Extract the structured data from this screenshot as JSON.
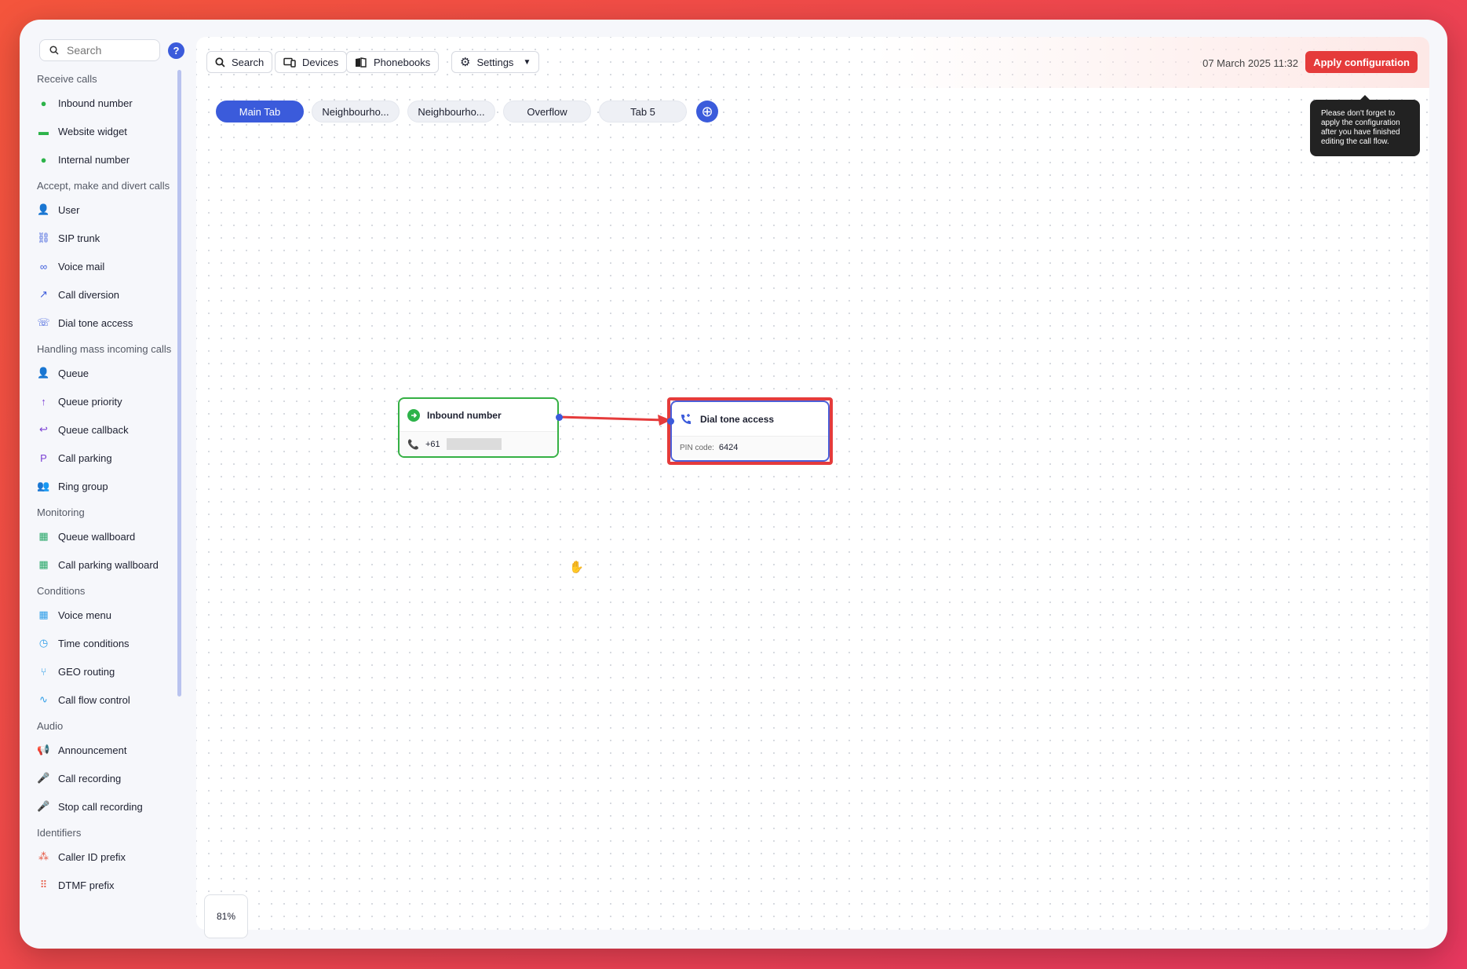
{
  "sidebar": {
    "search_placeholder": "Search",
    "help_label": "?",
    "sections": [
      {
        "title": "Receive calls",
        "items": [
          {
            "label": "Inbound number",
            "icon": "inbound-number-icon",
            "color": "#2db34a"
          },
          {
            "label": "Website widget",
            "icon": "website-widget-icon",
            "color": "#2db34a"
          },
          {
            "label": "Internal number",
            "icon": "internal-number-icon",
            "color": "#2db34a"
          }
        ]
      },
      {
        "title": "Accept, make and divert calls",
        "items": [
          {
            "label": "User",
            "icon": "user-icon",
            "color": "#3b5bdb"
          },
          {
            "label": "SIP trunk",
            "icon": "sip-trunk-icon",
            "color": "#3b5bdb"
          },
          {
            "label": "Voice mail",
            "icon": "voice-mail-icon",
            "color": "#3b5bdb"
          },
          {
            "label": "Call diversion",
            "icon": "call-diversion-icon",
            "color": "#3b5bdb"
          },
          {
            "label": "Dial tone access",
            "icon": "dial-tone-access-icon",
            "color": "#3b5bdb"
          }
        ]
      },
      {
        "title": "Handling mass incoming calls",
        "items": [
          {
            "label": "Queue",
            "icon": "queue-icon",
            "color": "#7b3fd4"
          },
          {
            "label": "Queue priority",
            "icon": "queue-priority-icon",
            "color": "#7b3fd4"
          },
          {
            "label": "Queue callback",
            "icon": "queue-callback-icon",
            "color": "#7b3fd4"
          },
          {
            "label": "Call parking",
            "icon": "call-parking-icon",
            "color": "#7b3fd4"
          },
          {
            "label": "Ring group",
            "icon": "ring-group-icon",
            "color": "#7b3fd4"
          }
        ]
      },
      {
        "title": "Monitoring",
        "items": [
          {
            "label": "Queue wallboard",
            "icon": "queue-wallboard-icon",
            "color": "#2aa86a"
          },
          {
            "label": "Call parking wallboard",
            "icon": "call-parking-wallboard-icon",
            "color": "#2aa86a"
          }
        ]
      },
      {
        "title": "Conditions",
        "items": [
          {
            "label": "Voice menu",
            "icon": "voice-menu-icon",
            "color": "#2f9ee8"
          },
          {
            "label": "Time conditions",
            "icon": "time-conditions-icon",
            "color": "#2f9ee8"
          },
          {
            "label": "GEO routing",
            "icon": "geo-routing-icon",
            "color": "#2f9ee8"
          },
          {
            "label": "Call flow control",
            "icon": "call-flow-control-icon",
            "color": "#2f9ee8"
          }
        ]
      },
      {
        "title": "Audio",
        "items": [
          {
            "label": "Announcement",
            "icon": "announcement-icon",
            "color": "#c0264f"
          },
          {
            "label": "Call recording",
            "icon": "call-recording-icon",
            "color": "#c0264f"
          },
          {
            "label": "Stop call recording",
            "icon": "stop-call-recording-icon",
            "color": "#c0264f"
          }
        ]
      },
      {
        "title": "Identifiers",
        "items": [
          {
            "label": "Caller ID prefix",
            "icon": "caller-id-prefix-icon",
            "color": "#e5533c"
          },
          {
            "label": "DTMF prefix",
            "icon": "dtmf-prefix-icon",
            "color": "#e5533c"
          }
        ]
      }
    ]
  },
  "toolbar": {
    "search_label": "Search",
    "devices_label": "Devices",
    "phonebooks_label": "Phonebooks",
    "settings_label": "Settings",
    "datetime": "07 March 2025 11:32",
    "apply_label": "Apply configuration",
    "tooltip": "Please don't forget to apply the configuration after you have finished editing the call flow."
  },
  "tabs": [
    "Main Tab",
    "Neighbourho...",
    "Neighbourho...",
    "Overflow",
    "Tab 5"
  ],
  "active_tab": "Main Tab",
  "nodes": {
    "inbound": {
      "title": "Inbound number",
      "number_prefix": "+61"
    },
    "dial": {
      "title": "Dial tone access",
      "pin_label": "PIN code:",
      "pin_value": "6424"
    }
  },
  "zoom": "81%",
  "colors": {
    "accent": "#3b5bdb",
    "apply": "#e53b3b",
    "inbound_border": "#35b044",
    "highlight": "#e53b3b"
  }
}
